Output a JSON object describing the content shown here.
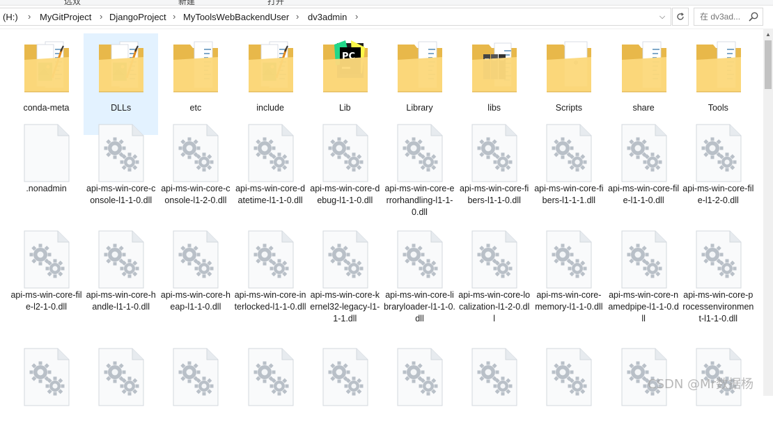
{
  "ribbon": [
    "远双",
    "新建",
    "打开"
  ],
  "address": {
    "crumbs": [
      "(H:)",
      "MyGitProject",
      "DjangoProject",
      "MyToolsWebBackendUser",
      "dv3admin"
    ]
  },
  "search": {
    "placeholder": "在 dv3ad..."
  },
  "folders": [
    {
      "label": "conda-meta",
      "kind": "docs-image"
    },
    {
      "label": "DLLs",
      "kind": "docs-image",
      "selected": true
    },
    {
      "label": "etc",
      "kind": "docs"
    },
    {
      "label": "include",
      "kind": "docs-image"
    },
    {
      "label": "Lib",
      "kind": "pycharm"
    },
    {
      "label": "Library",
      "kind": "docs"
    },
    {
      "label": "libs",
      "kind": "dark-docs"
    },
    {
      "label": "Scripts",
      "kind": "white-doc"
    },
    {
      "label": "share",
      "kind": "docs"
    },
    {
      "label": "Tools",
      "kind": "docs"
    }
  ],
  "files": [
    {
      "label": ".nonadmin",
      "icon": "blank"
    },
    {
      "label": "api-ms-win-core-console-l1-1-0.dll",
      "icon": "gear"
    },
    {
      "label": "api-ms-win-core-console-l1-2-0.dll",
      "icon": "gear"
    },
    {
      "label": "api-ms-win-core-datetime-l1-1-0.dll",
      "icon": "gear"
    },
    {
      "label": "api-ms-win-core-debug-l1-1-0.dll",
      "icon": "gear"
    },
    {
      "label": "api-ms-win-core-errorhandling-l1-1-0.dll",
      "icon": "gear"
    },
    {
      "label": "api-ms-win-core-fibers-l1-1-0.dll",
      "icon": "gear"
    },
    {
      "label": "api-ms-win-core-fibers-l1-1-1.dll",
      "icon": "gear"
    },
    {
      "label": "api-ms-win-core-file-l1-1-0.dll",
      "icon": "gear"
    },
    {
      "label": "api-ms-win-core-file-l1-2-0.dll",
      "icon": "gear"
    },
    {
      "label": "api-ms-win-core-file-l2-1-0.dll",
      "icon": "gear"
    },
    {
      "label": "api-ms-win-core-handle-l1-1-0.dll",
      "icon": "gear"
    },
    {
      "label": "api-ms-win-core-heap-l1-1-0.dll",
      "icon": "gear"
    },
    {
      "label": "api-ms-win-core-interlocked-l1-1-0.dll",
      "icon": "gear"
    },
    {
      "label": "api-ms-win-core-kernel32-legacy-l1-1-1.dll",
      "icon": "gear"
    },
    {
      "label": "api-ms-win-core-libraryloader-l1-1-0.dll",
      "icon": "gear"
    },
    {
      "label": "api-ms-win-core-localization-l1-2-0.dll",
      "icon": "gear"
    },
    {
      "label": "api-ms-win-core-memory-l1-1-0.dll",
      "icon": "gear"
    },
    {
      "label": "api-ms-win-core-namedpipe-l1-1-0.dll",
      "icon": "gear"
    },
    {
      "label": "api-ms-win-core-processenvironment-l1-1-0.dll",
      "icon": "gear"
    },
    {
      "label": "",
      "icon": "gear"
    },
    {
      "label": "",
      "icon": "gear"
    },
    {
      "label": "",
      "icon": "gear"
    },
    {
      "label": "",
      "icon": "gear"
    },
    {
      "label": "",
      "icon": "gear"
    },
    {
      "label": "",
      "icon": "gear"
    },
    {
      "label": "",
      "icon": "gear"
    },
    {
      "label": "",
      "icon": "gear"
    },
    {
      "label": "",
      "icon": "gear"
    },
    {
      "label": "",
      "icon": "gear"
    }
  ],
  "watermark": "CSDN @Mr数据杨",
  "colors": {
    "folder_back": "#e8b84a",
    "folder_front": "#fcd97c",
    "selection": "#cce8ff",
    "gear": "#b9c0c8"
  }
}
